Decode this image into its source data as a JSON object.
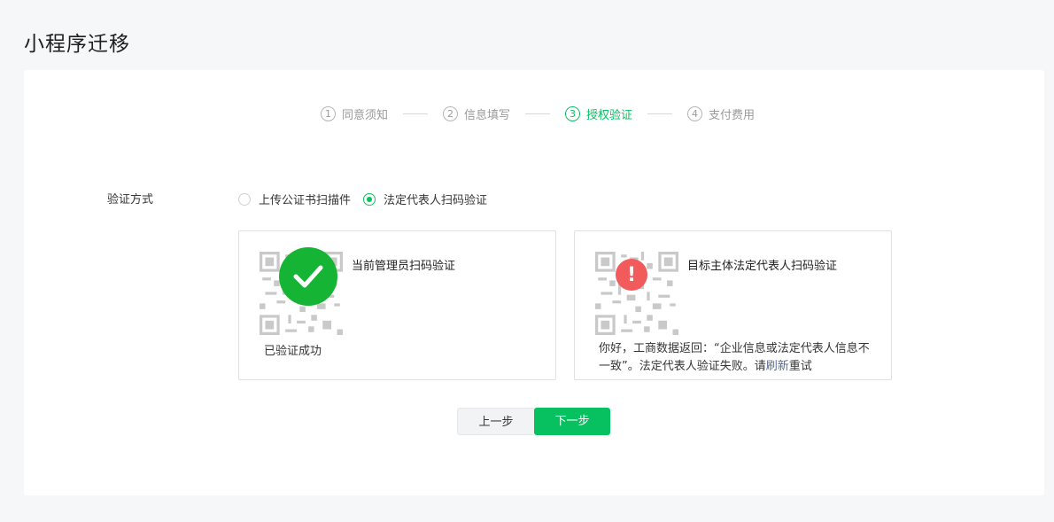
{
  "page": {
    "title": "小程序迁移"
  },
  "steps": [
    {
      "num": "1",
      "label": "同意须知"
    },
    {
      "num": "2",
      "label": "信息填写"
    },
    {
      "num": "3",
      "label": "授权验证"
    },
    {
      "num": "4",
      "label": "支付费用"
    }
  ],
  "active_step": 3,
  "form": {
    "label": "验证方式",
    "options": [
      "上传公证书扫描件",
      "法定代表人扫码验证"
    ],
    "selected": "法定代表人扫码验证"
  },
  "left_box": {
    "title": "当前管理员扫码验证",
    "status": "已验证成功",
    "icon": "check-circle-icon"
  },
  "right_box": {
    "title": "目标主体法定代表人扫码验证",
    "message_part1": "你好，工商数据返回：“企业信息或法定代表人信息不一致”。法定代表人验证失败。请",
    "link": "刷新",
    "message_part2": "重试",
    "icon": "exclamation-circle-icon"
  },
  "buttons": {
    "prev": "上一步",
    "next": "下一步"
  },
  "colors": {
    "accent": "#07c160",
    "success": "#15b434",
    "error": "#f25b5b",
    "link": "#576b95"
  }
}
